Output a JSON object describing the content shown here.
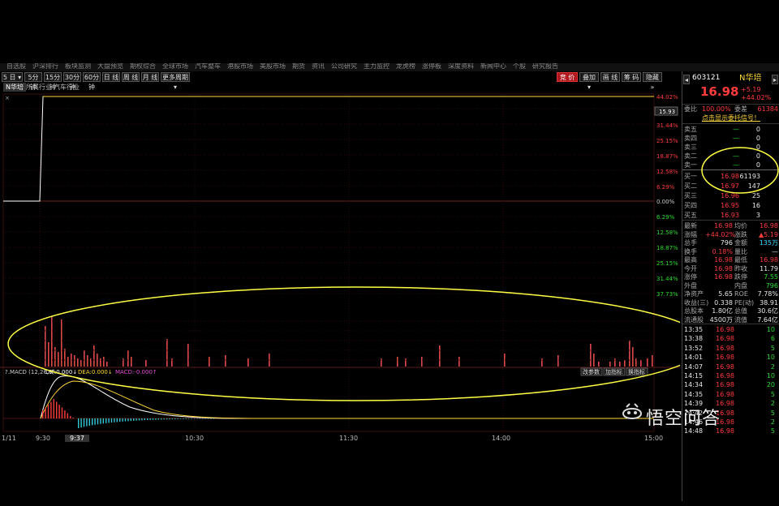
{
  "menu": [
    "自选股",
    "沪深排行",
    "板块监测",
    "大盘预览",
    "期权综合",
    "全球市场",
    "汽车整车",
    "港股市场",
    "美股市场",
    "期货",
    "资讯",
    "公司研究",
    "主力监控",
    "龙虎榜",
    "涨停板",
    "深度资料",
    "新闻中心",
    "个股",
    "研究报告"
  ],
  "toolbar": {
    "period_select": "5 日 ▾",
    "buttons": [
      "5分钟",
      "15分钟",
      "30分钟",
      "60分钟",
      "日 线",
      "周 线",
      "月 线",
      "更多周期 ▾"
    ],
    "right_buttons": [
      "竞 价",
      "叠加 ▾",
      "画 线",
      "筹 码",
      "隐藏 »"
    ]
  },
  "subtabs": {
    "stock": "N华培",
    "industry": "所属行业",
    "sector": "汽车行业"
  },
  "price_axis": {
    "current_price_box": "15.93",
    "right_labels_up": [
      "44.02%",
      "37.73%",
      "31.44%",
      "25.15%",
      "18.87%",
      "12.58%",
      "6.29%"
    ],
    "zero": "0.00%",
    "right_labels_down": [
      "6.29%",
      "12.58%",
      "18.87%",
      "25.15%",
      "31.44%",
      "37.73%"
    ]
  },
  "macd": {
    "header": "?.MACD (12,26,9)",
    "dif": "DIF:0.000↓",
    "dea": "DEA:0.000↓",
    "macd": "MACD:-0.000↑",
    "buttons": [
      "改参数",
      "加指标",
      "换指标"
    ]
  },
  "time_axis": {
    "date": "1/11",
    "labels": [
      "9:30",
      "10:30",
      "11:30",
      "14:00",
      "15:00"
    ],
    "cursor_time": "9:37"
  },
  "colors": {
    "up": "#ff3b3b",
    "down": "#2ddc2d",
    "highlight": "#ffff44",
    "line": "#ffffff",
    "avg": "#ffd83a",
    "vol": "#e04848",
    "macd_neg": "#33c9d6"
  },
  "quote": {
    "code": "603121",
    "name": "N华培",
    "price": "16.98",
    "change": "+5.19",
    "change_pct": "+44.02%",
    "weibi_label": "委比",
    "weibi": "100.00%",
    "weicha_label": "委差",
    "weicha": "61384",
    "banner": "点击显示委托信号！",
    "sell": [
      {
        "label": "卖五",
        "price": "—",
        "vol": "0"
      },
      {
        "label": "卖四",
        "price": "—",
        "vol": "0"
      },
      {
        "label": "卖三",
        "price": "—",
        "vol": "0"
      },
      {
        "label": "卖二",
        "price": "—",
        "vol": "0"
      },
      {
        "label": "卖一",
        "price": "—",
        "vol": "0"
      }
    ],
    "buy": [
      {
        "label": "买一",
        "price": "16.98",
        "vol": "61193"
      },
      {
        "label": "买二",
        "price": "16.97",
        "vol": "147"
      },
      {
        "label": "买三",
        "price": "16.96",
        "vol": "25"
      },
      {
        "label": "买四",
        "price": "16.95",
        "vol": "16"
      },
      {
        "label": "买五",
        "price": "16.93",
        "vol": "3"
      }
    ],
    "stats": [
      {
        "l1": "最新",
        "v1": "16.98",
        "l2": "均价",
        "v2": "16.98"
      },
      {
        "l1": "涨幅",
        "v1": "+44.02%",
        "l2": "涨跌",
        "v2": "▲5.19"
      },
      {
        "l1": "总手",
        "v1": "796",
        "l2": "金额",
        "v2": "135万"
      },
      {
        "l1": "换手",
        "v1": "0.18%",
        "l2": "量比",
        "v2": "—"
      },
      {
        "l1": "最高",
        "v1": "16.98",
        "l2": "最低",
        "v2": "16.98"
      },
      {
        "l1": "今开",
        "v1": "16.98",
        "l2": "昨收",
        "v2": "11.79"
      },
      {
        "l1": "涨停",
        "v1": "16.98",
        "l2": "跌停",
        "v2": "7.55"
      },
      {
        "l1": "外盘",
        "v1": "",
        "l2": "内盘",
        "v2": "796"
      },
      {
        "l1": "净资产",
        "v1": "5.65",
        "l2": "ROE",
        "v2": "7.78%"
      },
      {
        "l1": "收益(三)",
        "v1": "0.338",
        "l2": "PE(动)",
        "v2": "38.91"
      },
      {
        "l1": "总股本",
        "v1": "1.80亿",
        "l2": "总值",
        "v2": "30.6亿"
      },
      {
        "l1": "流通股",
        "v1": "4500万",
        "l2": "流值",
        "v2": "7.64亿"
      }
    ],
    "trades": [
      {
        "time": "13:35",
        "price": "16.98",
        "vol": "10"
      },
      {
        "time": "13:38",
        "price": "16.98",
        "vol": "6"
      },
      {
        "time": "13:52",
        "price": "16.98",
        "vol": "5"
      },
      {
        "time": "14:01",
        "price": "16.98",
        "vol": "10"
      },
      {
        "time": "14:07",
        "price": "16.98",
        "vol": "2"
      },
      {
        "time": "14:15",
        "price": "16.98",
        "vol": "10"
      },
      {
        "time": "14:34",
        "price": "16.98",
        "vol": "20"
      },
      {
        "time": "14:35",
        "price": "16.98",
        "vol": "5"
      },
      {
        "time": "14:39",
        "price": "16.98",
        "vol": "2"
      },
      {
        "time": "14:42",
        "price": "16.98",
        "vol": "5"
      },
      {
        "time": "14:46",
        "price": "16.98",
        "vol": "2"
      },
      {
        "time": "14:48",
        "price": "16.98",
        "vol": "5"
      }
    ]
  },
  "watermark": "悟空问答"
}
